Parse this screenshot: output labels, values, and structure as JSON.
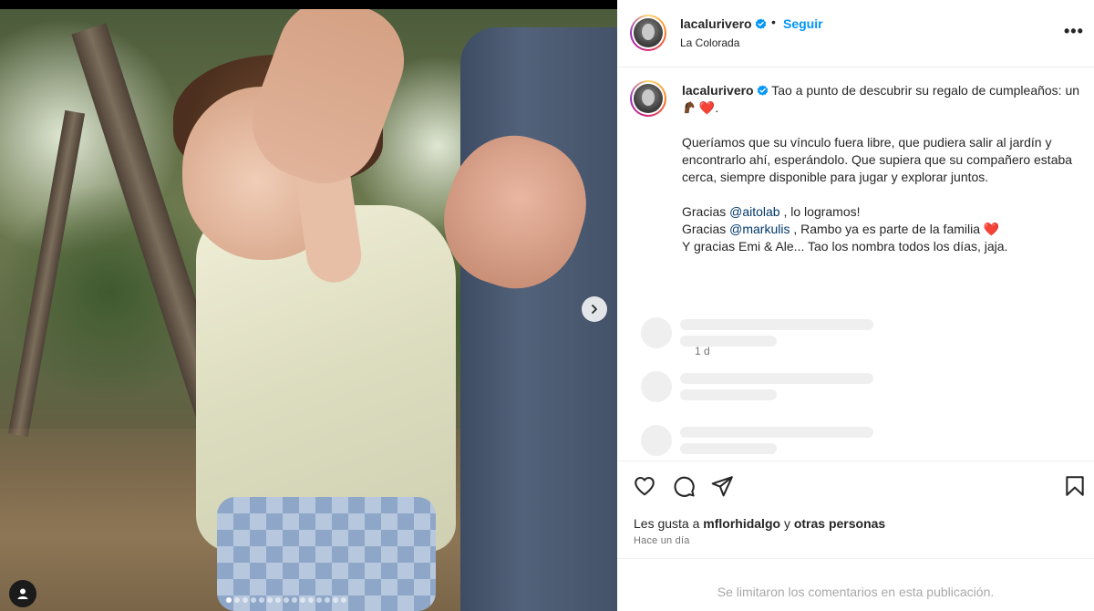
{
  "post": {
    "username": "lacalurivero",
    "separator": "•",
    "follow_label": "Seguir",
    "location": "La Colorada",
    "more_icon": "more-options-icon",
    "more_label": "•••"
  },
  "caption": {
    "username": "lacalurivero",
    "line1": "Tao a punto de descubrir su regalo de cumpleaños: un",
    "line1_end": ".",
    "paragraph2": "Queríamos que su vínculo fuera libre, que pudiera salir al jardín y encontrarlo ahí, esperándolo. Que supiera que su compañero estaba cerca, siempre disponible para jugar y explorar juntos.",
    "thanks1_prefix": "Gracias",
    "thanks1_mention": "@aitolab",
    "thanks1_suffix": ", lo logramos!",
    "thanks2_prefix": "Gracias",
    "thanks2_mention": "@markulis",
    "thanks2_suffix": ", Rambo ya es parte de la familia",
    "thanks3": "Y gracias Emi & Ale... Tao los nombra todos los días, jaja.",
    "heart": "❤️",
    "age": "1 d"
  },
  "engagement": {
    "likes_prefix": "Les gusta a",
    "likes_user": "mflorhidalgo",
    "likes_joiner": "y",
    "likes_others": "otras personas",
    "date": "Hace un día",
    "comments_limited": "Se limitaron los comentarios en esta publicación."
  },
  "carousel": {
    "total_slides": 15,
    "active_index": 0
  },
  "colors": {
    "accent": "#0095f6",
    "heart": "#e0245e",
    "muted": "#737373"
  }
}
